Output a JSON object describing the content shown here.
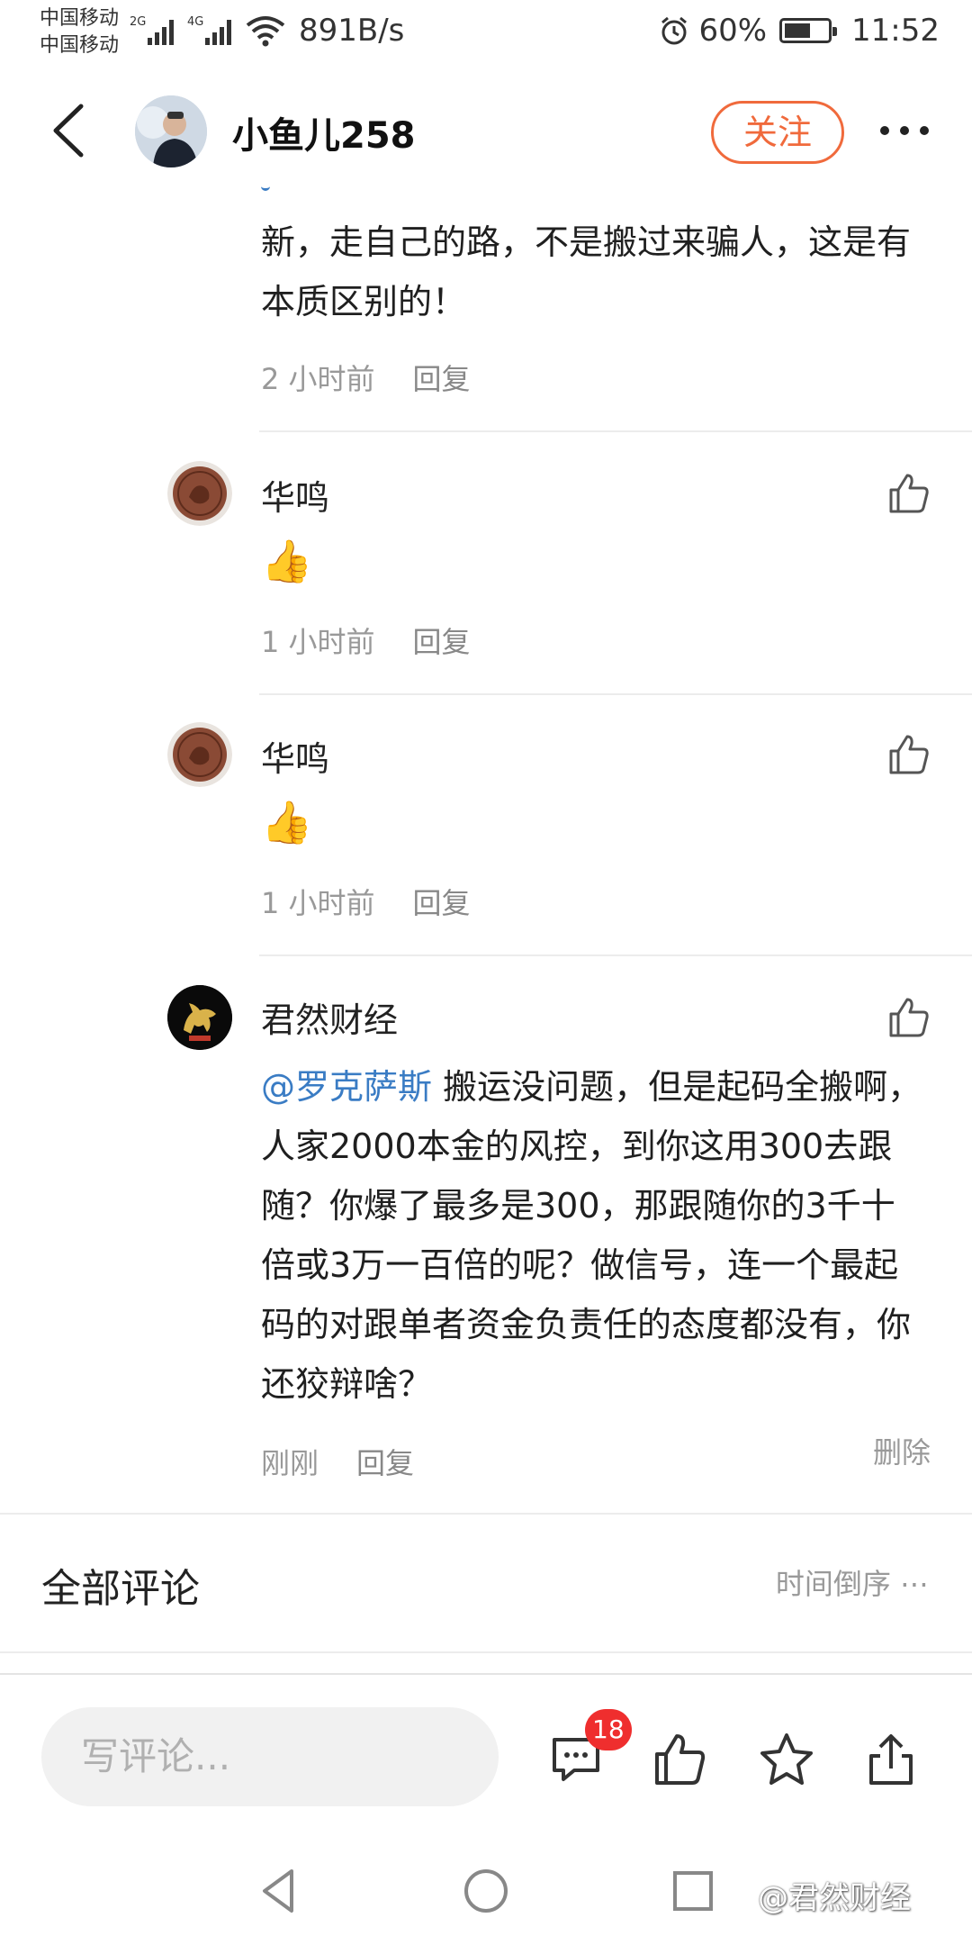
{
  "status_bar": {
    "carrier1": "中国移动",
    "carrier2": "中国移动",
    "net1": "2G",
    "net2": "4G",
    "speed": "891B/s",
    "battery": "60%",
    "battery_level": 0.6,
    "time": "11:52"
  },
  "header": {
    "user_name": "小鱼儿258",
    "follow_label": "关注"
  },
  "comments": [
    {
      "text": "新，走自己的路，不是搬过来骗人，这是有本质区别的！",
      "time": "2 小时前",
      "reply": "回复"
    },
    {
      "user": "华鸣",
      "text": "👍",
      "time": "1 小时前",
      "reply": "回复"
    },
    {
      "user": "华鸣",
      "text": "👍",
      "time": "1 小时前",
      "reply": "回复"
    },
    {
      "user": "君然财经",
      "mention": "@罗克萨斯",
      "text": " 搬运没问题，但是起码全搬啊，人家2000本金的风控，到你这用300去跟随？你爆了最多是300，那跟随你的3千十倍或3万一百倍的呢？做信号，连一个最起码的对跟单者资金负责任的态度都没有，你还狡辩啥？",
      "time": "刚刚",
      "reply": "回复",
      "delete": "删除"
    }
  ],
  "all_comments": {
    "title": "全部评论",
    "sort": "时间倒序 ⋯"
  },
  "toolbar": {
    "input_placeholder": "写评论...",
    "comment_count": "18"
  },
  "watermark": "@君然财经",
  "colors": {
    "accent": "#f06a3c",
    "mention": "#3a7cc4",
    "badge": "#ef2e2e"
  }
}
